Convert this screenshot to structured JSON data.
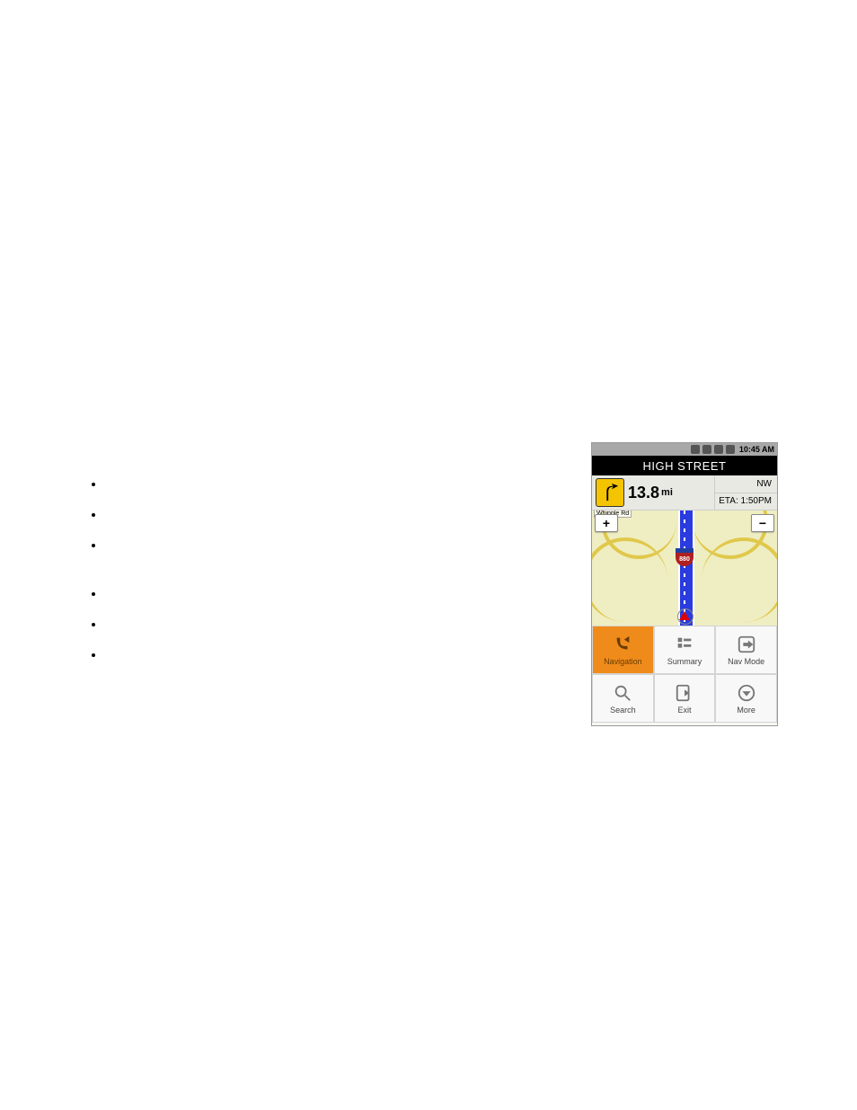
{
  "bullets": [
    "",
    "",
    "",
    "",
    "",
    ""
  ],
  "phone": {
    "status": {
      "time": "10:45 AM"
    },
    "street": "HIGH STREET",
    "turn": {
      "distance": "13.8",
      "unit": "mi",
      "icon": "bear-right"
    },
    "compass": "NW",
    "eta": "ETA: 1:50PM",
    "map": {
      "highway_shield": "880",
      "road_label": "Whipple Rd",
      "zoom_in": "+",
      "zoom_out": "−"
    },
    "menu": [
      {
        "id": "navigation",
        "label": "Navigation",
        "icon": "phone-arrow",
        "active": true
      },
      {
        "id": "summary",
        "label": "Summary",
        "icon": "list",
        "active": false
      },
      {
        "id": "navmode",
        "label": "Nav Mode",
        "icon": "arrow-box",
        "active": false
      },
      {
        "id": "search",
        "label": "Search",
        "icon": "magnifier",
        "active": false
      },
      {
        "id": "exit",
        "label": "Exit",
        "icon": "exit",
        "active": false
      },
      {
        "id": "more",
        "label": "More",
        "icon": "chevron-down-circle",
        "active": false
      }
    ]
  }
}
